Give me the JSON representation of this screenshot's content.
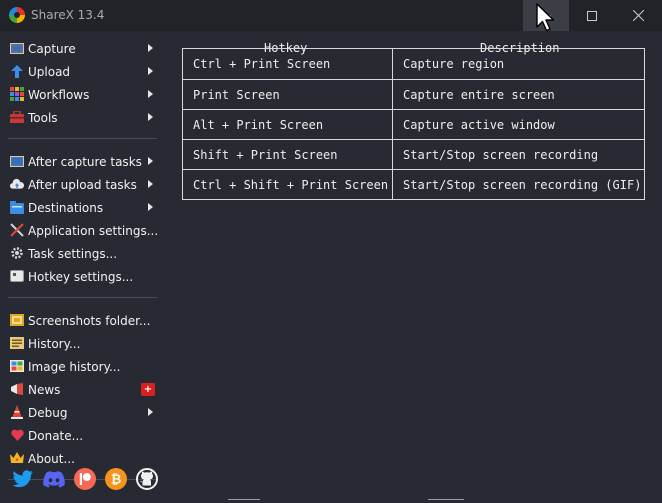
{
  "window": {
    "title": "ShareX 13.4",
    "minimize_glyph": "—",
    "maximize_glyph": "☐",
    "close_glyph": "✕"
  },
  "menu": {
    "group1": [
      {
        "label": "Capture",
        "icon": "capture-icon",
        "submenu": true
      },
      {
        "label": "Upload",
        "icon": "upload-icon",
        "submenu": true
      },
      {
        "label": "Workflows",
        "icon": "workflows-icon",
        "submenu": true
      },
      {
        "label": "Tools",
        "icon": "tools-icon",
        "submenu": true
      }
    ],
    "group2": [
      {
        "label": "After capture tasks",
        "icon": "after-capture-icon",
        "submenu": true
      },
      {
        "label": "After upload tasks",
        "icon": "after-upload-icon",
        "submenu": true
      },
      {
        "label": "Destinations",
        "icon": "destinations-icon",
        "submenu": true
      },
      {
        "label": "Application settings...",
        "icon": "application-settings-icon",
        "submenu": false
      },
      {
        "label": "Task settings...",
        "icon": "task-settings-icon",
        "submenu": false
      },
      {
        "label": "Hotkey settings...",
        "icon": "hotkey-settings-icon",
        "submenu": false
      }
    ],
    "group3": [
      {
        "label": "Screenshots folder...",
        "icon": "folder-icon",
        "submenu": false
      },
      {
        "label": "History...",
        "icon": "history-icon",
        "submenu": false
      },
      {
        "label": "Image history...",
        "icon": "image-history-icon",
        "submenu": false
      },
      {
        "label": "News",
        "icon": "news-icon",
        "submenu": false,
        "badge": "+"
      },
      {
        "label": "Debug",
        "icon": "debug-icon",
        "submenu": true
      },
      {
        "label": "Donate...",
        "icon": "heart-icon",
        "submenu": false
      },
      {
        "label": "About...",
        "icon": "crown-icon",
        "submenu": false
      }
    ]
  },
  "social": [
    "twitter-icon",
    "discord-icon",
    "patreon-icon",
    "bitcoin-icon",
    "github-icon"
  ],
  "hotkeys": {
    "header_hotkey": "Hotkey",
    "header_description": "Description",
    "rows": [
      {
        "hotkey": "Ctrl + Print Screen",
        "description": "Capture region"
      },
      {
        "hotkey": "Print Screen",
        "description": "Capture entire screen"
      },
      {
        "hotkey": "Alt + Print Screen",
        "description": "Capture active window"
      },
      {
        "hotkey": "Shift + Print Screen",
        "description": "Start/Stop screen recording"
      },
      {
        "hotkey": "Ctrl + Shift + Print Screen",
        "description": "Start/Stop screen recording (GIF)"
      }
    ]
  },
  "colors": {
    "background": "#282a33",
    "titlebar": "#222329",
    "badge": "#d8201f",
    "table_border": "#d8d8d8"
  }
}
